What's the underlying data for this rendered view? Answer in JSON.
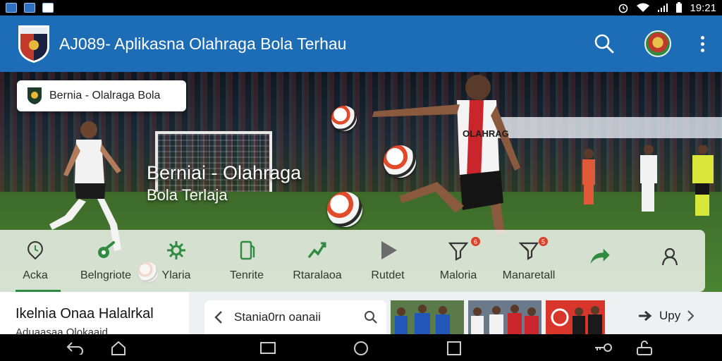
{
  "statusbar": {
    "time": "19:21"
  },
  "appbar": {
    "title": "AJ089- Aplikasna Olahraga  Bola Terhau"
  },
  "hero": {
    "chip_label": "Bernia - Olalraga Bola",
    "title_line1": "Berniai - Olahraga",
    "title_line2": "Bola Terlaja",
    "player_shirt_text": "OLAHRAG"
  },
  "nav": {
    "items": [
      {
        "label": "Acka",
        "icon": "clock-pin-icon"
      },
      {
        "label": "Belngriote",
        "icon": "whistle-icon"
      },
      {
        "label": "Ylaria",
        "icon": "gear-icon"
      },
      {
        "label": "Tenrite",
        "icon": "tablet-icon"
      },
      {
        "label": "Rtaralaoa",
        "icon": "trend-icon"
      },
      {
        "label": "Rutdet",
        "icon": "play-icon"
      },
      {
        "label": "Maloria",
        "icon": "funnel-icon",
        "badge": "6"
      },
      {
        "label": "Manaretall",
        "icon": "trophy-icon",
        "badge": "5"
      },
      {
        "label": "",
        "icon": "share-arrow-icon"
      },
      {
        "label": "",
        "icon": "person-icon"
      }
    ]
  },
  "content": {
    "card_title": "Ikelnia Onaa Halalrkal",
    "card_subtitle": "Aduaasaa Olokaaid",
    "search_text": "Stania0rn oanaii",
    "next_label": "Upy"
  },
  "colors": {
    "appbar": "#1d6cb6",
    "accent_green": "#2e8b3f",
    "badge_red": "#d9432a"
  }
}
